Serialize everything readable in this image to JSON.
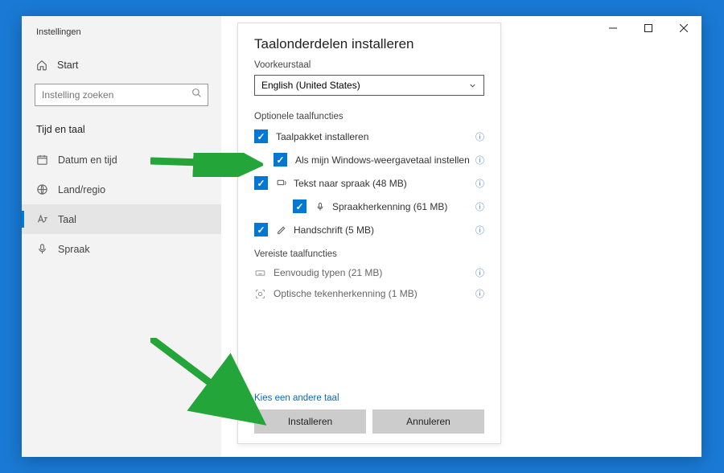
{
  "sidebar": {
    "app_title": "Instellingen",
    "home_label": "Start",
    "search_placeholder": "Instelling zoeken",
    "category": "Tijd en taal",
    "items": [
      {
        "label": "Datum en tijd"
      },
      {
        "label": "Land/regio"
      },
      {
        "label": "Taal"
      },
      {
        "label": "Spraak"
      }
    ]
  },
  "modal": {
    "title": "Taalonderdelen installeren",
    "pref_label": "Voorkeurstaal",
    "selected_lang": "English (United States)",
    "optional_section": "Optionele taalfuncties",
    "required_section": "Vereiste taalfuncties",
    "options": {
      "install_pack": "Taalpakket installeren",
      "set_display": "Als mijn Windows-weergavetaal instellen",
      "tts": "Tekst naar spraak (48 MB)",
      "speech_rec": "Spraakherkenning (61 MB)",
      "handwriting": "Handschrift (5 MB)"
    },
    "required": {
      "basic_typing": "Eenvoudig typen (21 MB)",
      "ocr": "Optische tekenherkenning (1 MB)"
    },
    "choose_other": "Kies een andere taal",
    "install_btn": "Installeren",
    "cancel_btn": "Annuleren"
  }
}
